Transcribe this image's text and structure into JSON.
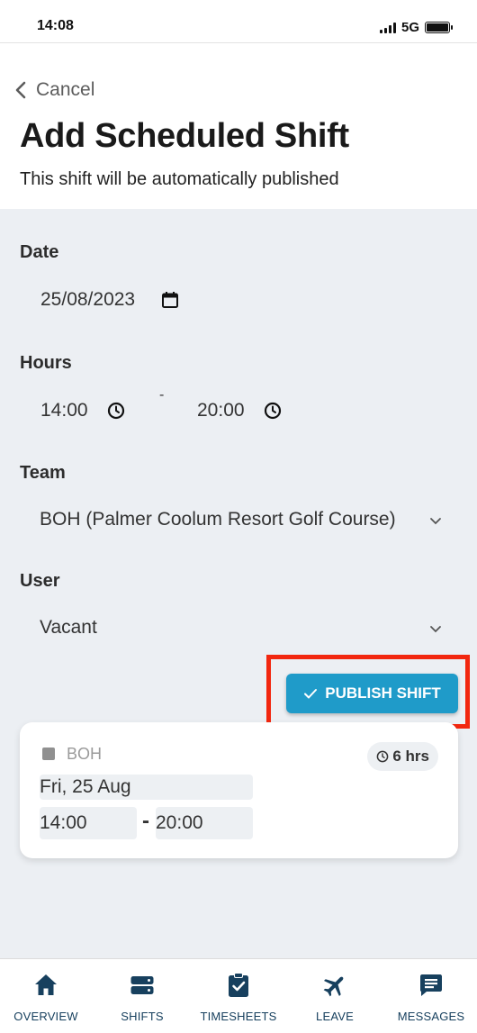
{
  "status_bar": {
    "time": "14:08",
    "network": "5G",
    "battery_level": 1.0
  },
  "header": {
    "back_label": "Cancel",
    "title": "Add Scheduled Shift",
    "subtitle": "This shift will be automatically published"
  },
  "form": {
    "date": {
      "label": "Date",
      "value": "25/08/2023"
    },
    "hours": {
      "label": "Hours",
      "start": "14:00",
      "separator": "-",
      "end": "20:00"
    },
    "team": {
      "label": "Team",
      "value": "BOH (Palmer Coolum Resort Golf Course)"
    },
    "user": {
      "label": "User",
      "value": "Vacant"
    }
  },
  "publish_button": {
    "label": "PUBLISH SHIFT"
  },
  "shift_card": {
    "team": "BOH",
    "duration": "6 hrs",
    "day": "Fri, 25 Aug",
    "start": "14:00",
    "separator": "-",
    "end": "20:00"
  },
  "tabs": [
    {
      "label": "OVERVIEW",
      "icon": "home-icon"
    },
    {
      "label": "SHIFTS",
      "icon": "shifts-icon"
    },
    {
      "label": "TIMESHEETS",
      "icon": "timesheets-icon"
    },
    {
      "label": "LEAVE",
      "icon": "airplane-icon"
    },
    {
      "label": "MESSAGES",
      "icon": "messages-icon"
    }
  ],
  "colors": {
    "accent": "#1f9bc9",
    "highlight": "#f2270f",
    "tab_icon": "#17405e"
  }
}
